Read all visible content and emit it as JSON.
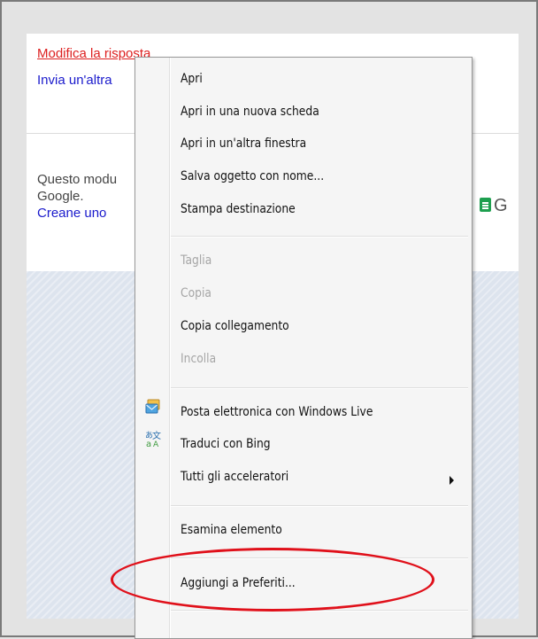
{
  "page": {
    "edit_response_link": "Modifica la risposta",
    "send_another_link": "Invia un'altra",
    "footer_text_line1": "Questo modu",
    "footer_text_line2": "Google.",
    "create_link": "Creane uno",
    "logo_letter": "G"
  },
  "context_menu": {
    "group1": [
      "Apri",
      "Apri in una nuova scheda",
      "Apri in un'altra finestra",
      "Salva oggetto con nome...",
      "Stampa destinazione"
    ],
    "group2": [
      {
        "label": "Taglia",
        "enabled": false
      },
      {
        "label": "Copia",
        "enabled": false
      },
      {
        "label": "Copia collegamento",
        "enabled": true
      },
      {
        "label": "Incolla",
        "enabled": false
      }
    ],
    "group3": [
      {
        "label": "Posta elettronica con Windows Live",
        "icon": "windows-live-mail-icon"
      },
      {
        "label": "Traduci con Bing",
        "icon": "bing-translate-icon"
      },
      {
        "label": "Tutti gli acceleratori",
        "icon": "submenu-arrow-icon"
      }
    ],
    "inspect": "Esamina elemento",
    "add_favorites": "Aggiungi a Preferiti..."
  },
  "colors": {
    "highlight_ellipse": "#e0101a",
    "link_red": "#dd2020",
    "link_blue": "#1a1acc"
  }
}
